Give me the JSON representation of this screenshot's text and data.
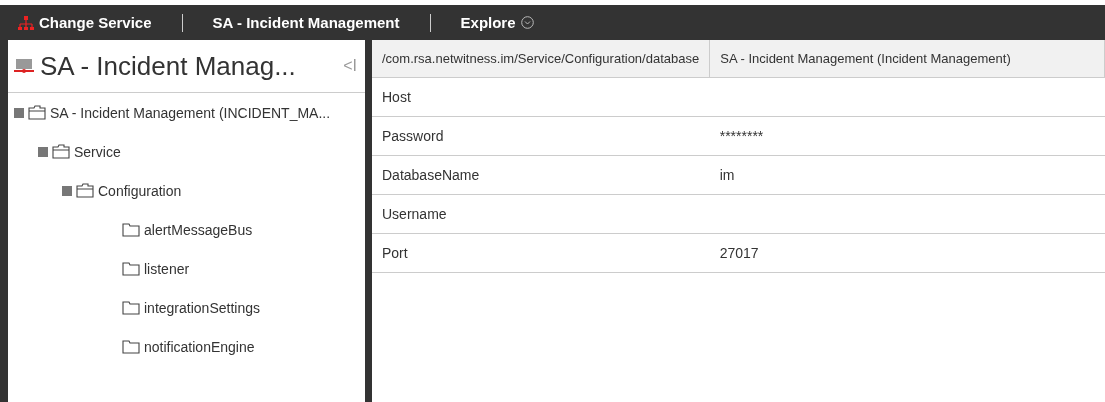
{
  "topbar": {
    "items": [
      {
        "kind": "service",
        "label": "Change Service"
      },
      {
        "kind": "text",
        "label": "SA - Incident Management"
      },
      {
        "kind": "menu",
        "label": "Explore"
      }
    ]
  },
  "sidebar": {
    "title": "SA - Incident Manag...",
    "collapse": "<I",
    "tree": [
      {
        "label": "SA - Incident Management (INCIDENT_MA...",
        "expanded": true,
        "children": [
          {
            "label": "Service",
            "expanded": true,
            "children": [
              {
                "label": "Configuration",
                "expanded": true,
                "children": [
                  {
                    "label": "alertMessageBus"
                  },
                  {
                    "label": "listener"
                  },
                  {
                    "label": "integrationSettings"
                  },
                  {
                    "label": "notificationEngine"
                  }
                ]
              }
            ]
          }
        ]
      }
    ]
  },
  "table": {
    "columns": [
      "/com.rsa.netwitness.im/Service/Configuration/database",
      "SA - Incident Management (Incident Management)"
    ],
    "rows": [
      [
        "Host",
        ""
      ],
      [
        "Password",
        "********"
      ],
      [
        "DatabaseName",
        "im"
      ],
      [
        "Username",
        ""
      ],
      [
        "Port",
        "27017"
      ]
    ]
  }
}
